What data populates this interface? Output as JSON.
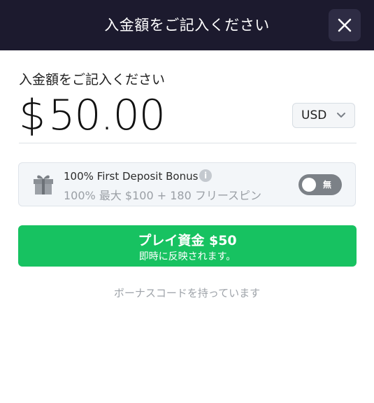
{
  "header": {
    "title": "入金額をご記入ください",
    "close_icon": "close-icon"
  },
  "amount": {
    "label": "入金額をご記入ください",
    "currency_sign": "$",
    "value": "50.00"
  },
  "currency_select": {
    "selected": "USD",
    "icon": "chevron-down-icon"
  },
  "bonus": {
    "icon": "gift-icon",
    "title": "100% First Deposit Bonus",
    "info_icon": "info-icon",
    "info_glyph": "i",
    "subtitle": "100% 最大 $100 + 180 フリースピン",
    "toggle_label": "無",
    "toggle_on": false
  },
  "play_button": {
    "main": "プレイ資金 $50",
    "sub": "即時に反映されます。"
  },
  "bonus_code_link": "ボーナスコードを持っています",
  "colors": {
    "header_bg": "#1c1a2e",
    "primary_green": "#17c261",
    "toggle_off": "#7c8187"
  }
}
